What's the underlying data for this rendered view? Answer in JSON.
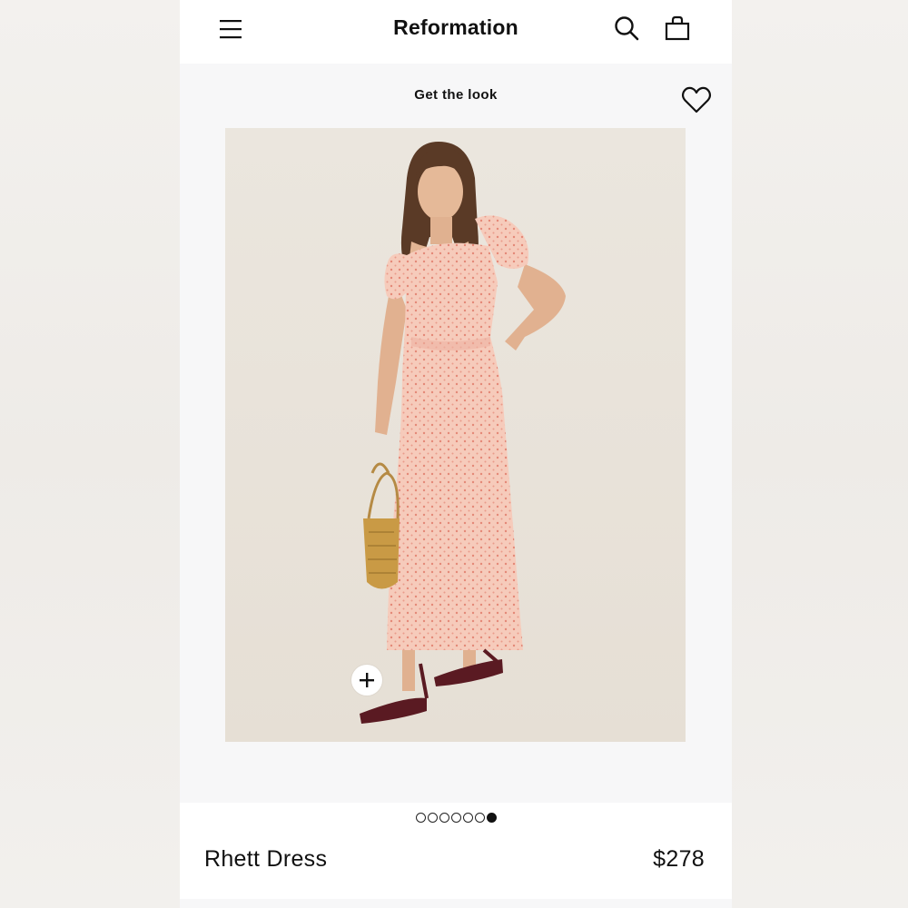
{
  "header": {
    "brand": "Reformation",
    "icons": [
      "menu-icon",
      "search-icon",
      "bag-icon"
    ]
  },
  "section": {
    "title": "Get the look",
    "favorite_icon": "heart-icon"
  },
  "image": {
    "alt": "Model wearing pink printed puff-sleeve maxi dress with woven basket bag and burgundy strappy sandals",
    "add_icon": "plus-icon"
  },
  "carousel": {
    "total": 7,
    "active_index": 6
  },
  "product": {
    "name": "Rhett Dress",
    "price": "$278"
  },
  "colors": {
    "dress": "#f6c9b9",
    "dress_dots": "#e8897a",
    "background": "#ebe5dc",
    "sandals": "#5a1a22",
    "bag": "#c99a45"
  }
}
